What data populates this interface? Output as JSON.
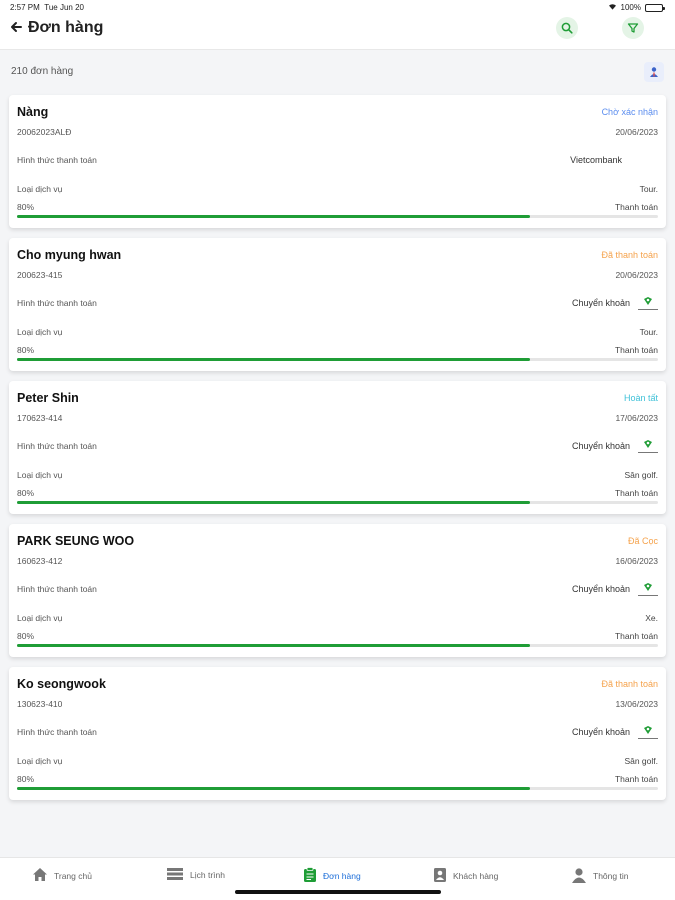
{
  "statusbar": {
    "time": "2:57 PM",
    "date": "Tue Jun 20",
    "battery": "100%"
  },
  "header": {
    "title": "Đơn hàng",
    "back_icon": "arrow-left-icon",
    "search_icon": "search-icon",
    "filter_icon": "filter-icon"
  },
  "summary": {
    "count": "210 đơn hàng",
    "export_icon": "person-upload-icon"
  },
  "labels": {
    "payment_method": "Hình thức thanh toán",
    "service_type": "Loại dịch vụ"
  },
  "orders": [
    {
      "name": "Nàng",
      "code": "20062023ALĐ",
      "status": "Chờ xác nhận",
      "status_color": "#5b8def",
      "date": "20/06/2023",
      "payment": "Vietcombank",
      "service": "Tour.",
      "percent": "80%",
      "progress": 0.8,
      "payment_state": "Thanh toán"
    },
    {
      "name": "Cho myung hwan",
      "code": "200623-415",
      "status": "Đã thanh toán",
      "status_color": "#f5a24b",
      "date": "20/06/2023",
      "payment": "Chuyển khoản",
      "service": "Tour.",
      "percent": "80%",
      "progress": 0.8,
      "payment_state": "Thanh toán"
    },
    {
      "name": "Peter Shin",
      "code": "170623-414",
      "status": "Hoàn tất",
      "status_color": "#3fc1d8",
      "date": "17/06/2023",
      "payment": "Chuyển khoản",
      "service": "Sân golf.",
      "percent": "80%",
      "progress": 0.8,
      "payment_state": "Thanh toán"
    },
    {
      "name": "PARK SEUNG WOO",
      "code": "160623-412",
      "status": "Đã Cọc",
      "status_color": "#f5a24b",
      "date": "16/06/2023",
      "payment": "Chuyển khoản",
      "service": "Xe.",
      "percent": "80%",
      "progress": 0.8,
      "payment_state": "Thanh toán"
    },
    {
      "name": "Ko seongwook",
      "code": "130623-410",
      "status": "Đã thanh toán",
      "status_color": "#f5a24b",
      "date": "13/06/2023",
      "payment": "Chuyển khoản",
      "service": "Sân golf.",
      "percent": "80%",
      "progress": 0.8,
      "payment_state": "Thanh toán"
    }
  ],
  "tabs": [
    {
      "label": "Trang chủ",
      "icon": "home-icon"
    },
    {
      "label": "Lịch trình",
      "icon": "schedule-icon"
    },
    {
      "label": "Đơn hàng",
      "icon": "clipboard-icon",
      "active": true
    },
    {
      "label": "Khách hàng",
      "icon": "contact-icon"
    },
    {
      "label": "Thông tin",
      "icon": "user-icon"
    }
  ],
  "colors": {
    "accent_green": "#1f9d36",
    "active_tab": "#1e6fd9"
  }
}
